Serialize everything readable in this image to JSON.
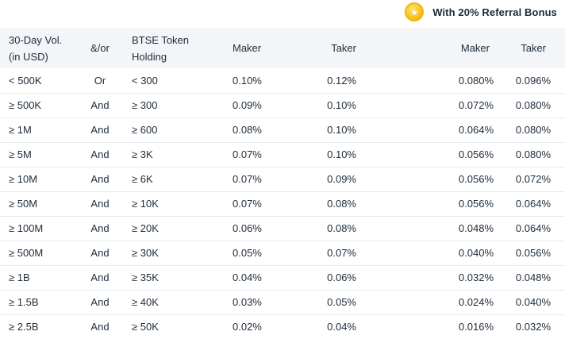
{
  "referral_banner": {
    "icon": "star-coin-icon",
    "label": "With 20% Referral Bonus",
    "icon_color": "#f6c21a"
  },
  "table": {
    "headers": {
      "volume_line1": "30-Day Vol.",
      "volume_line2": "(in USD)",
      "andor": "&/or",
      "token_line1": "BTSE Token",
      "token_line2": "Holding",
      "maker": "Maker",
      "taker": "Taker",
      "maker_referral": "Maker",
      "taker_referral": "Taker"
    },
    "rows": [
      {
        "volume": "< 500K",
        "andor": "Or",
        "token": "< 300",
        "maker": "0.10%",
        "taker": "0.12%",
        "maker_referral": "0.080%",
        "taker_referral": "0.096%"
      },
      {
        "volume": "≥ 500K",
        "andor": "And",
        "token": "≥ 300",
        "maker": "0.09%",
        "taker": "0.10%",
        "maker_referral": "0.072%",
        "taker_referral": "0.080%"
      },
      {
        "volume": "≥ 1M",
        "andor": "And",
        "token": "≥ 600",
        "maker": "0.08%",
        "taker": "0.10%",
        "maker_referral": "0.064%",
        "taker_referral": "0.080%"
      },
      {
        "volume": "≥ 5M",
        "andor": "And",
        "token": "≥ 3K",
        "maker": "0.07%",
        "taker": "0.10%",
        "maker_referral": "0.056%",
        "taker_referral": "0.080%"
      },
      {
        "volume": "≥ 10M",
        "andor": "And",
        "token": "≥ 6K",
        "maker": "0.07%",
        "taker": "0.09%",
        "maker_referral": "0.056%",
        "taker_referral": "0.072%"
      },
      {
        "volume": "≥ 50M",
        "andor": "And",
        "token": "≥ 10K",
        "maker": "0.07%",
        "taker": "0.08%",
        "maker_referral": "0.056%",
        "taker_referral": "0.064%"
      },
      {
        "volume": "≥ 100M",
        "andor": "And",
        "token": "≥ 20K",
        "maker": "0.06%",
        "taker": "0.08%",
        "maker_referral": "0.048%",
        "taker_referral": "0.064%"
      },
      {
        "volume": "≥ 500M",
        "andor": "And",
        "token": "≥ 30K",
        "maker": "0.05%",
        "taker": "0.07%",
        "maker_referral": "0.040%",
        "taker_referral": "0.056%"
      },
      {
        "volume": "≥ 1B",
        "andor": "And",
        "token": "≥ 35K",
        "maker": "0.04%",
        "taker": "0.06%",
        "maker_referral": "0.032%",
        "taker_referral": "0.048%"
      },
      {
        "volume": "≥ 1.5B",
        "andor": "And",
        "token": "≥ 40K",
        "maker": "0.03%",
        "taker": "0.05%",
        "maker_referral": "0.024%",
        "taker_referral": "0.040%"
      },
      {
        "volume": "≥ 2.5B",
        "andor": "And",
        "token": "≥ 50K",
        "maker": "0.02%",
        "taker": "0.04%",
        "maker_referral": "0.016%",
        "taker_referral": "0.032%"
      }
    ]
  }
}
